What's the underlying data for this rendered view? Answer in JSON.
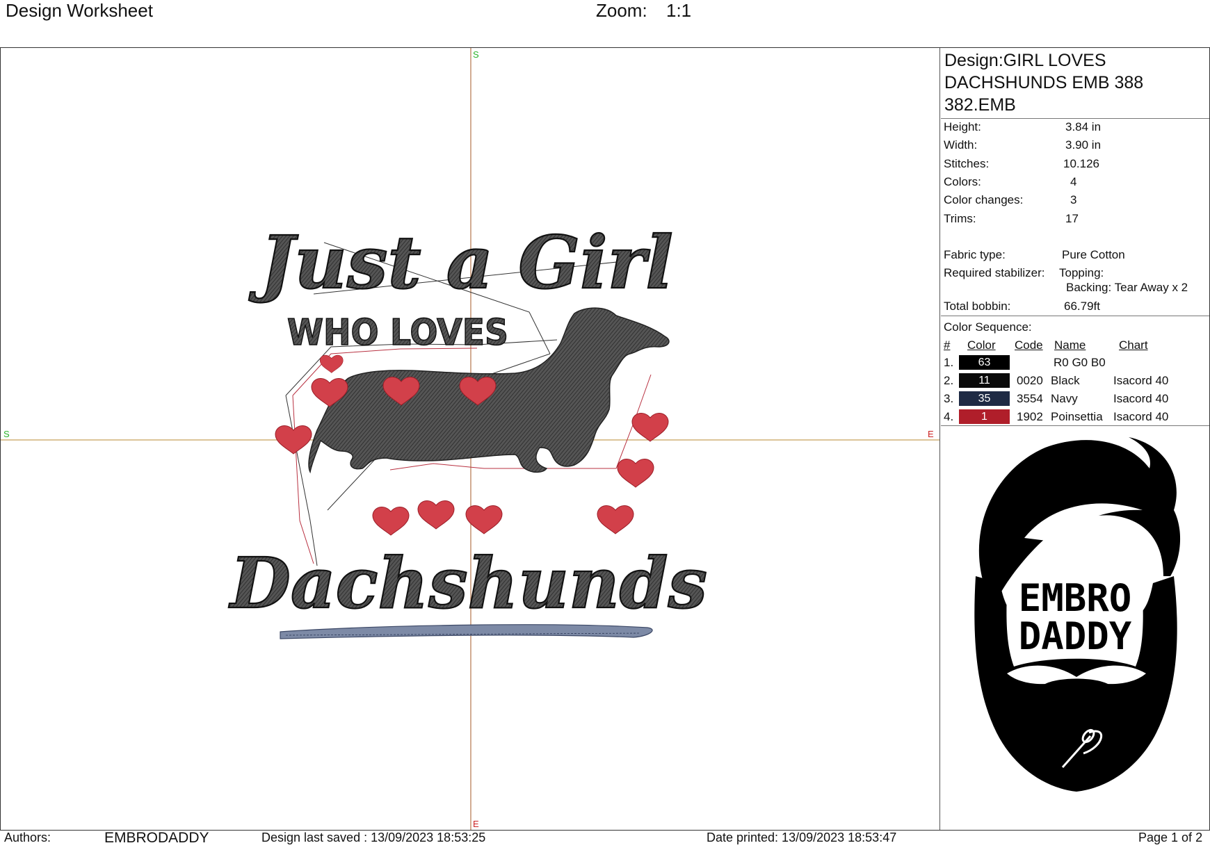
{
  "header": {
    "title": "Design Worksheet",
    "zoom_label": "Zoom:",
    "zoom_value": "1:1"
  },
  "canvas": {
    "axis_labels": {
      "top": "S",
      "bottom": "E",
      "left": "S",
      "right": "E"
    },
    "artwork": {
      "line1": "Just a Girl",
      "line2": "WHO LOVES",
      "line3": "Dachshunds"
    }
  },
  "panel": {
    "design_name": [
      "Design:GIRL LOVES",
      "DACHSHUNDS EMB 388",
      "382.EMB"
    ],
    "stats": [
      {
        "label": "Height:",
        "value": "3.84 in"
      },
      {
        "label": "Width:",
        "value": "3.90 in"
      },
      {
        "label": "Stitches:",
        "value": "10.126"
      },
      {
        "label": "Colors:",
        "value": "4"
      },
      {
        "label": "Color changes:",
        "value": "3"
      },
      {
        "label": "Trims:",
        "value": "17"
      }
    ],
    "fabric_label": "Fabric type:",
    "fabric_value": "Pure Cotton",
    "stabilizer_label": "Required stabilizer:",
    "topping": "Topping:",
    "backing": "Backing: Tear Away x 2",
    "bobbin_label": "Total bobbin:",
    "bobbin_value": "66.79ft",
    "sequence_title": "Color Sequence:",
    "sequence_headers": {
      "num": "#",
      "color": "Color",
      "code": "Code",
      "name": "Name",
      "chart": "Chart"
    },
    "sequence": [
      {
        "num": "1.",
        "swatch_label": "63",
        "swatch": "#000000",
        "code": "",
        "name": "R0 G0 B0",
        "chart": ""
      },
      {
        "num": "2.",
        "swatch_label": "11",
        "swatch": "#0a0a0a",
        "code": "0020",
        "name": "Black",
        "chart": "Isacord 40"
      },
      {
        "num": "3.",
        "swatch_label": "35",
        "swatch": "#1e2a44",
        "code": "3554",
        "name": "Navy",
        "chart": "Isacord 40"
      },
      {
        "num": "4.",
        "swatch_label": "1",
        "swatch": "#b01e2a",
        "code": "1902",
        "name": "Poinsettia",
        "chart": "Isacord 40"
      }
    ],
    "logo": {
      "line1": "EMBRO",
      "line2": "DADDY"
    }
  },
  "footer": {
    "authors_label": "Authors:",
    "authors_value": "EMBRODADDY",
    "saved": "Design last saved : 13/09/2023 18:53:25",
    "printed": "Date printed: 13/09/2023 18:53:47",
    "page": "Page 1 of 2"
  }
}
